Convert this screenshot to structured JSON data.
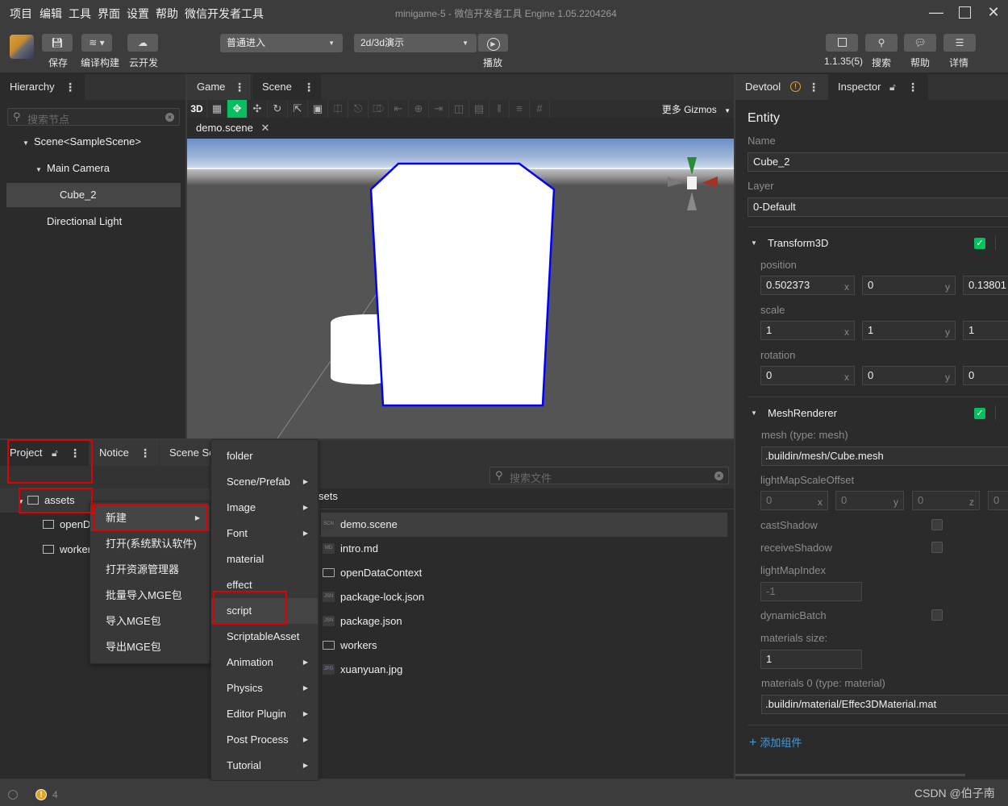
{
  "menubar": {
    "items": [
      "项目",
      "编辑",
      "工具",
      "界面",
      "设置",
      "帮助",
      "微信开发者工具"
    ],
    "window_title": "minigame-5 - 微信开发者工具 Engine 1.05.2204264"
  },
  "toolbar": {
    "save_label": "保存",
    "build_label": "编译构建",
    "cloud_label": "云开发",
    "mode_select": "普通进入",
    "scene_select": "2d/3d演示",
    "play_label": "播放",
    "version_label": "1.1.35(5)",
    "search_label": "搜索",
    "help_label": "帮助",
    "detail_label": "详情"
  },
  "hierarchy": {
    "tab_label": "Hierarchy",
    "search_placeholder": "搜索节点",
    "nodes": [
      {
        "label": "Scene<SampleScene>",
        "expanded": true
      },
      {
        "label": "Main Camera",
        "expanded": true
      },
      {
        "label": "Cube_2",
        "selected": true
      },
      {
        "label": "Directional Light"
      }
    ]
  },
  "scene": {
    "tabs": [
      "Game",
      "Scene"
    ],
    "mode_3d": "3D",
    "more_label": "更多",
    "gizmos_label": "Gizmos",
    "file_tab": "demo.scene"
  },
  "inspector": {
    "tabs": [
      "Devtool",
      "Inspector"
    ],
    "entity_title": "Entity",
    "name_label": "Name",
    "name_value": "Cube_2",
    "layer_label": "Layer",
    "layer_value": "0-Default",
    "transform": {
      "title": "Transform3D",
      "enabled": true,
      "position_label": "position",
      "position": [
        "0.502373",
        "0",
        "0.13801"
      ],
      "scale_label": "scale",
      "scale": [
        "1",
        "1",
        "1"
      ],
      "rotation_label": "rotation",
      "rotation": [
        "0",
        "0",
        "0"
      ],
      "axes": [
        "x",
        "y",
        "z"
      ]
    },
    "mesh_renderer": {
      "title": "MeshRenderer",
      "enabled": true,
      "mesh_label": "mesh (type: mesh)",
      "mesh_value": ".buildin/mesh/Cube.mesh",
      "lightmap_offset_label": "lightMapScaleOffset",
      "lightmap_offset": [
        "0",
        "0",
        "0",
        "0"
      ],
      "lightmap_axes": [
        "x",
        "y",
        "z"
      ],
      "cast_shadow_label": "castShadow",
      "cast_shadow": false,
      "receive_shadow_label": "receiveShadow",
      "receive_shadow": false,
      "lightmap_index_label": "lightMapIndex",
      "lightmap_index": "-1",
      "dynamic_batch_label": "dynamicBatch",
      "dynamic_batch": false,
      "materials_size_label": "materials size:",
      "materials_size": "1",
      "material0_label": "materials 0 (type: material)",
      "material0_value": ".buildin/material/Effec3DMaterial.mat"
    },
    "add_component": "添加组件"
  },
  "project": {
    "tabs": [
      "Project",
      "Notice",
      "Scene Se"
    ],
    "tree": [
      {
        "label": "assets",
        "expanded": true
      },
      {
        "label": "openD"
      },
      {
        "label": "worker"
      }
    ],
    "search_placeholder": "搜索文件",
    "breadcrumb": "sets",
    "files": [
      {
        "name": "demo.scene",
        "type": "SCN",
        "selected": true
      },
      {
        "name": "intro.md",
        "type": "MD"
      },
      {
        "name": "openDataContext",
        "type": "folder"
      },
      {
        "name": "package-lock.json",
        "type": "JSN"
      },
      {
        "name": "package.json",
        "type": "JSN"
      },
      {
        "name": "workers",
        "type": "folder"
      },
      {
        "name": "xuanyuan.jpg",
        "type": "JPG"
      }
    ]
  },
  "context_menu": {
    "items": [
      {
        "label": "新建",
        "submenu": true,
        "highlighted": true
      },
      {
        "label": "打开(系统默认软件)"
      },
      {
        "label": "打开资源管理器"
      },
      {
        "label": "批量导入MGE包"
      },
      {
        "label": "导入MGE包"
      },
      {
        "label": "导出MGE包"
      }
    ]
  },
  "submenu": {
    "items": [
      {
        "label": "folder"
      },
      {
        "label": "Scene/Prefab",
        "submenu": true
      },
      {
        "label": "Image",
        "submenu": true
      },
      {
        "label": "Font",
        "submenu": true
      },
      {
        "label": "material"
      },
      {
        "label": "effect"
      },
      {
        "label": "script",
        "highlighted": true
      },
      {
        "label": "ScriptableAsset"
      },
      {
        "label": "Animation",
        "submenu": true
      },
      {
        "label": "Physics",
        "submenu": true
      },
      {
        "label": "Editor Plugin",
        "submenu": true
      },
      {
        "label": "Post Process",
        "submenu": true
      },
      {
        "label": "Tutorial",
        "submenu": true
      }
    ]
  },
  "statusbar": {
    "warning_count": "4",
    "watermark": "CSDN @伯子南"
  },
  "colors": {
    "accent_green": "#05c05f",
    "link_blue": "#3b9ee8",
    "selection_outline": "#0000ff",
    "annotation_red": "#e00000",
    "warning_orange": "#e8a21b"
  }
}
